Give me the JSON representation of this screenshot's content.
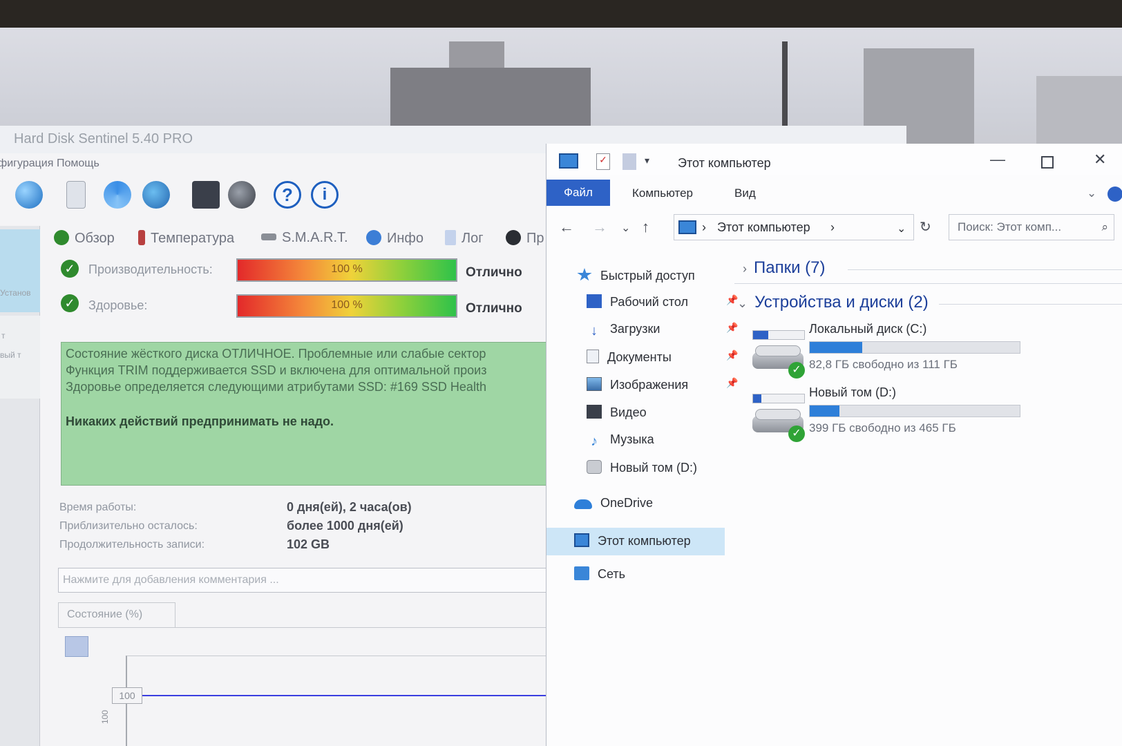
{
  "hds": {
    "title": "Hard Disk Sentinel 5.40 PRO",
    "menu": [
      "Конфигурация",
      "Помощь"
    ],
    "sidebar_texts": [
      "Установ",
      "т",
      "вый т"
    ],
    "tabs": [
      "Обзор",
      "Температура",
      "S.M.A.R.T.",
      "Инфо",
      "Лог",
      "Пр"
    ],
    "performance": {
      "label": "Производительность:",
      "percent_text": "100 %",
      "percent": 100,
      "rating": "Отлично"
    },
    "health": {
      "label": "Здоровье:",
      "percent_text": "100 %",
      "percent": 100,
      "rating": "Отлично"
    },
    "status_lines": [
      "Состояние жёсткого диска ОТЛИЧНОЕ. Проблемные или слабые сектор",
      "Функция TRIM поддерживается SSD и включена для оптимальной произ",
      "Здоровье определяется следующими атрибутами SSD: #169 SSD Health"
    ],
    "status_action": "Никаких действий предпринимать не надо.",
    "info": [
      {
        "label": "Время работы:",
        "value": "0 дня(ей), 2 часа(ов)"
      },
      {
        "label": "Приблизительно осталось:",
        "value": "более 1000 дня(ей)"
      },
      {
        "label": "Продолжительность записи:",
        "value": "102 GB"
      }
    ],
    "comment_placeholder": "Нажмите для добавления комментария ...",
    "state_tab": "Состояние (%)",
    "chart_label": "100",
    "chart_axis_label": "100"
  },
  "explorer": {
    "title": "Этот компьютер",
    "ribbon": {
      "file": "Файл",
      "computer": "Компьютер",
      "view": "Вид"
    },
    "address": "Этот компьютер",
    "search_placeholder": "Поиск: Этот комп...",
    "nav": {
      "quick_access": "Быстрый доступ",
      "desktop": "Рабочий стол",
      "downloads": "Загрузки",
      "documents": "Документы",
      "images": "Изображения",
      "video": "Видео",
      "music": "Музыка",
      "new_volume": "Новый том (D:)",
      "onedrive": "OneDrive",
      "this_pc": "Этот компьютер",
      "network": "Сеть"
    },
    "groups": {
      "folders": "Папки (7)",
      "devices": "Устройства и диски (2)"
    },
    "drives": [
      {
        "name": "Локальный диск (C:)",
        "free": "82,8 ГБ свободно из 111 ГБ",
        "used_fraction": 0.25
      },
      {
        "name": "Новый том (D:)",
        "free": "399 ГБ свободно из 465 ГБ",
        "used_fraction": 0.14
      }
    ]
  },
  "colors": {
    "accent": "#2e62c6",
    "status_bg": "#9fd6a4",
    "chart_line": "#3b3ee0"
  }
}
